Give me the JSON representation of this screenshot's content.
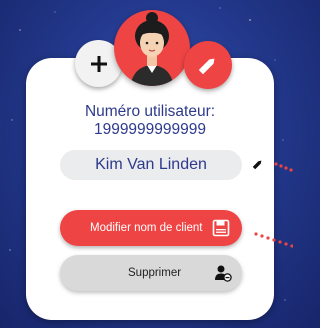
{
  "user": {
    "number_label": "Numéro utilisateur:",
    "number_value": "1999999999999",
    "name": "Kim Van Linden"
  },
  "actions": {
    "modify_label": "Modifier nom de client",
    "delete_label": "Supprimer"
  },
  "icons": {
    "add": "plus-icon",
    "edit": "pencil-icon",
    "save": "floppy-disk-icon",
    "delete_user": "user-minus-icon"
  },
  "colors": {
    "accent": "#ef4444",
    "text_primary": "#2e3a8c",
    "background": "#243a8f"
  }
}
